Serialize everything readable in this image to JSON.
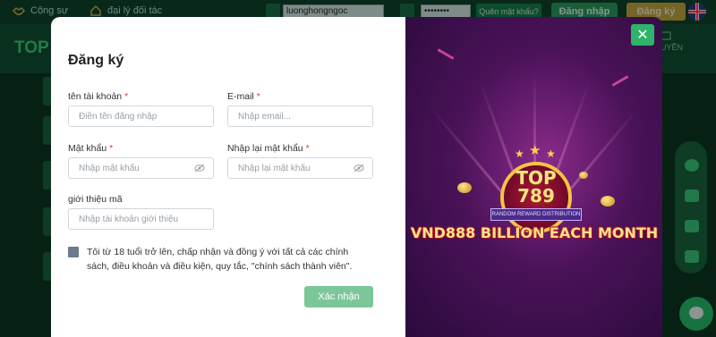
{
  "topbar": {
    "partner_label": "Cộng sự",
    "agent_label": "đại lý đối tác",
    "username_value": "luonghongngoc",
    "password_value": "••••••••",
    "forgot_label": "Quên mật khẩu?",
    "login_label": "Đăng nhập",
    "register_label": "Đăng ký"
  },
  "site": {
    "logo_text": "TOP",
    "right_icon_label": "UYỀN"
  },
  "modal": {
    "title": "Đăng ký",
    "fields": {
      "account": {
        "label": "tên tài khoản",
        "placeholder": "Điền tên đăng nhập"
      },
      "email": {
        "label": "E-mail",
        "placeholder": "Nhập email..."
      },
      "password": {
        "label": "Mật khẩu",
        "placeholder": "Nhập mật khẩu"
      },
      "password_confirm": {
        "label": "Nhập lại mật khẩu",
        "placeholder": "Nhập lại mật khẩu"
      },
      "referral": {
        "label": "giới thiệu mã",
        "placeholder": "Nhập tài khoản giới thiệu"
      }
    },
    "required_mark": "*",
    "terms_text": "Tôi từ 18 tuổi trở lên, chấp nhận và đồng ý với tất cả các chính sách, điều khoản và điều kiện, quy tắc, \"chính sách thành viên\".",
    "submit_label": "Xác nhận",
    "close_glyph": "✕"
  },
  "promo": {
    "badge_line1": "TOP",
    "badge_line2": "789",
    "ribbon_text": "RANDOM REWARD DISTRIBUTION",
    "headline": "VND888 BILLION EACH MONTH"
  },
  "colors": {
    "brand_green": "#2fb26a",
    "register_gold": "#d8a63c",
    "submit_disabled": "#7cc79a"
  }
}
